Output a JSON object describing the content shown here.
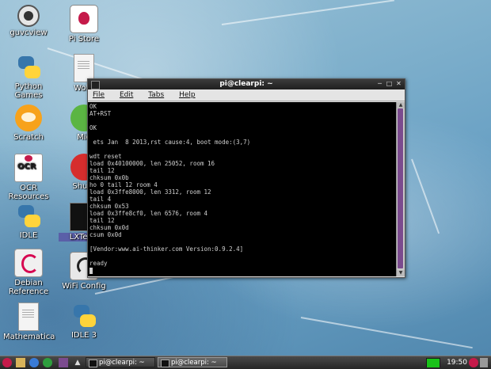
{
  "desktop": {
    "icons": [
      {
        "label": "guvcview",
        "icon": "webcam-icon"
      },
      {
        "label": "Pi Store",
        "icon": "pi-store-icon"
      },
      {
        "label": "Python\nGames",
        "icon": "python-icon"
      },
      {
        "label": "Wolfr",
        "icon": "document-icon"
      },
      {
        "label": "Scratch",
        "icon": "scratch-icon"
      },
      {
        "label": "Mid",
        "icon": "mid-icon"
      },
      {
        "label": "OCR\nResources",
        "icon": "ocr-icon"
      },
      {
        "label": "Shutd",
        "icon": "shutdown-icon"
      },
      {
        "label": "IDLE",
        "icon": "python-icon"
      },
      {
        "label": "LXTerm",
        "icon": "terminal-icon"
      },
      {
        "label": "Debian\nReference",
        "icon": "debian-icon"
      },
      {
        "label": "WiFi Config",
        "icon": "wifi-icon"
      },
      {
        "label": "Mathematica",
        "icon": "document-icon"
      },
      {
        "label": "IDLE 3",
        "icon": "python-icon"
      }
    ]
  },
  "window": {
    "title": "pi@clearpi: ~",
    "menu": [
      "File",
      "Edit",
      "Tabs",
      "Help"
    ],
    "terminal_lines": [
      "OK",
      "AT+RST",
      "",
      "OK",
      "",
      " ets Jan  8 2013,rst cause:4, boot mode:(3,7)",
      "",
      "wdt reset",
      "load 0x40100000, len 25052, room 16",
      "tail 12",
      "chksum 0x0b",
      "ho 0 tail 12 room 4",
      "load 0x3ffe8000, len 3312, room 12",
      "tail 4",
      "chksum 0x53",
      "load 0x3ffe8cf0, len 6576, room 4",
      "tail 12",
      "chksum 0x0d",
      "csum 0x0d",
      "",
      "[Vendor:www.ai-thinker.com Version:0.9.2.4]",
      "",
      "ready"
    ]
  },
  "taskbar": {
    "tasks": [
      "pi@clearpi: ~",
      "pi@clearpi: ~"
    ],
    "clock": "19:50"
  },
  "colors": {
    "scroll_thumb": "#7b4b8e",
    "cpu_meter": "#19c219",
    "terminal_bg": "#000000"
  }
}
